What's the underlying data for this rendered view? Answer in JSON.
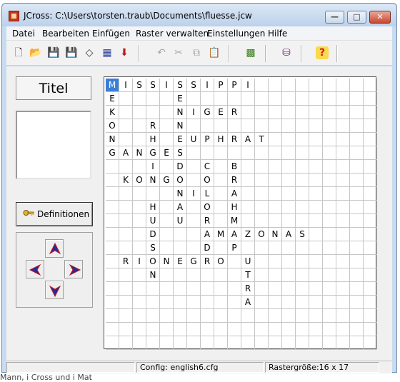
{
  "window": {
    "title": "JCross: C:\\Users\\torsten.traub\\Documents\\fluesse.jcw",
    "controls": {
      "minimize": "—",
      "maximize": "□",
      "close": "✕"
    }
  },
  "menu": [
    "Datei",
    "Bearbeiten",
    "Einfügen",
    "Raster verwalten",
    "Einstellungen",
    "Hilfe"
  ],
  "toolbar": {
    "tools": [
      {
        "name": "new-icon",
        "glyph": "🗋"
      },
      {
        "name": "open-icon",
        "glyph": "📂"
      },
      {
        "name": "save-icon",
        "glyph": "💾"
      },
      {
        "name": "save-as-icon",
        "glyph": "💾"
      },
      {
        "name": "eraser-icon",
        "glyph": "◇"
      },
      {
        "name": "grid-pattern-icon",
        "glyph": "▦"
      },
      {
        "name": "arrow-down-icon",
        "glyph": "⬇"
      },
      {
        "name": "undo-icon",
        "glyph": "↶"
      },
      {
        "name": "cut-icon",
        "glyph": "✂"
      },
      {
        "name": "copy-icon",
        "glyph": "⧉"
      },
      {
        "name": "paste-icon",
        "glyph": "📋"
      },
      {
        "name": "grid-star-icon",
        "glyph": "▩"
      },
      {
        "name": "export-icon",
        "glyph": "⛁"
      },
      {
        "name": "help-icon",
        "glyph": "?"
      }
    ]
  },
  "left_panel": {
    "title": "Titel",
    "definitions_button": "Definitionen"
  },
  "grid": {
    "rows": [
      "MISSISSIPPI         ",
      "E    E              ",
      "K    NIGER          ",
      "O  R N              ",
      "N  H EUPHRAT        ",
      "GANGES              ",
      "   I D C B          ",
      " KONGO O R          ",
      "     NIL A          ",
      "   H A O H          ",
      "   U U R M          ",
      "   D   AMAZONAS     ",
      "   S   D P          ",
      " RIONEGRO U         ",
      "   N      T         ",
      "          R         ",
      "          A         ",
      "                    ",
      "                    ",
      "                    "
    ],
    "selected": "M"
  },
  "status": {
    "config": "Config: english6.cfg",
    "size": "Rastergröße:16 x 17"
  },
  "below_text": "Mann, i Cross und i Mat"
}
